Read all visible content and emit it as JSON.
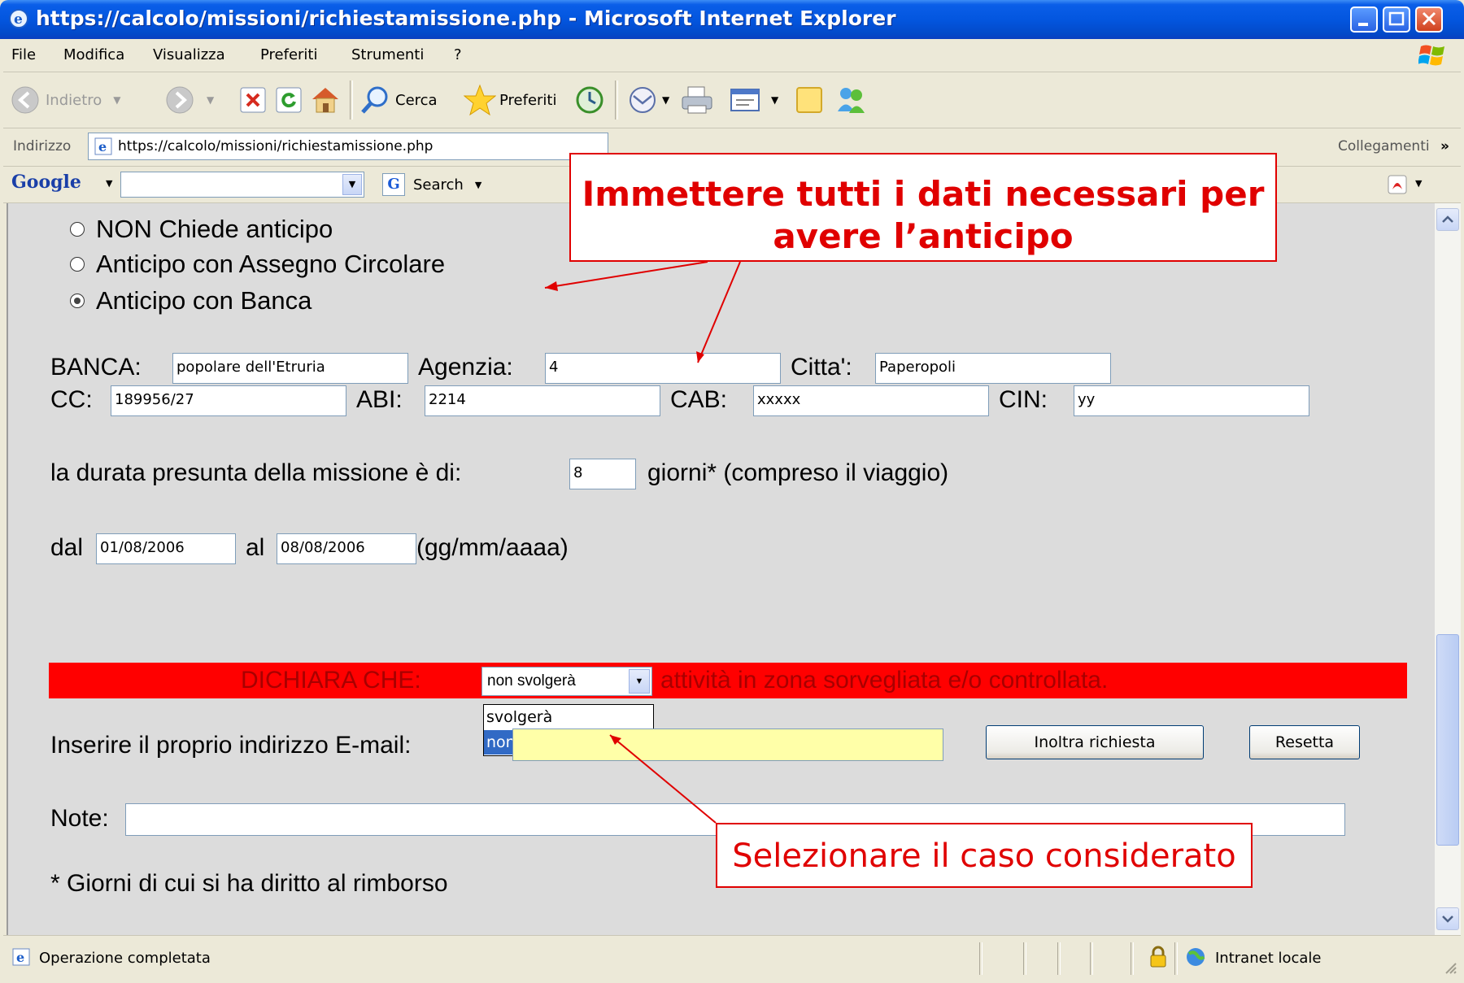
{
  "window": {
    "title": "https://calcolo/missioni/richiestamissione.php - Microsoft Internet Explorer"
  },
  "menu": {
    "items": [
      "File",
      "Modifica",
      "Visualizza",
      "Preferiti",
      "Strumenti",
      "?"
    ],
    "underlines": [
      "F",
      "M",
      "V",
      "P",
      "S",
      "?"
    ]
  },
  "toolbar": {
    "back_label": "Indietro",
    "search_label": "Cerca",
    "favorites_label": "Preferiti"
  },
  "address": {
    "label": "Indirizzo",
    "url": "https://calcolo/missioni/richiestamissione.php",
    "links_label": "Collegamenti",
    "chevron": "»"
  },
  "google": {
    "logo": "Google",
    "search_label": "Search"
  },
  "form": {
    "radio_options": [
      {
        "label": "NON Chiede anticipo",
        "selected": false
      },
      {
        "label": "Anticipo con Assegno Circolare",
        "selected": false
      },
      {
        "label": "Anticipo con Banca",
        "selected": true
      }
    ],
    "banca_label": "BANCA:",
    "banca_value": "popolare dell'Etruria",
    "agenzia_label": "Agenzia:",
    "agenzia_value": "4",
    "citta_label": "Citta':",
    "citta_value": "Paperopoli",
    "cc_label": "CC:",
    "cc_value": "189956/27",
    "abi_label": "ABI:",
    "abi_value": "2214",
    "cab_label": "CAB:",
    "cab_value": "xxxxx",
    "cin_label": "CIN:",
    "cin_value": "yy",
    "durata_label": "la durata presunta della missione è di:",
    "durata_value": "8",
    "giorni_label": "giorni* (compreso il viaggio)",
    "dal_label": "dal",
    "dal_value": "01/08/2006",
    "al_label": "al",
    "al_value": "08/08/2006",
    "date_format": "(gg/mm/aaaa)",
    "dichiara_label": "DICHIARA CHE:",
    "dichiara_selected": "non svolgerà",
    "dichiara_suffix": "attività in zona sorvegliata e/o controllata.",
    "dichiara_options": [
      "svolgerà",
      "non svolgerà"
    ],
    "email_label": "Inserire il proprio indirizzo E-mail:",
    "email_value": "",
    "submit_label": "Inoltra richiesta",
    "reset_label": "Resetta",
    "note_label": "Note:",
    "note_value": "",
    "footnote": "* Giorni di cui si ha diritto al rimborso"
  },
  "callouts": {
    "top_line1": "Immettere tutti i dati necessari per",
    "top_line2": "avere l’anticipo",
    "bottom": "Selezionare il caso considerato",
    "color": "#e00000"
  },
  "status": {
    "text": "Operazione completata",
    "zone": "Intranet locale"
  }
}
